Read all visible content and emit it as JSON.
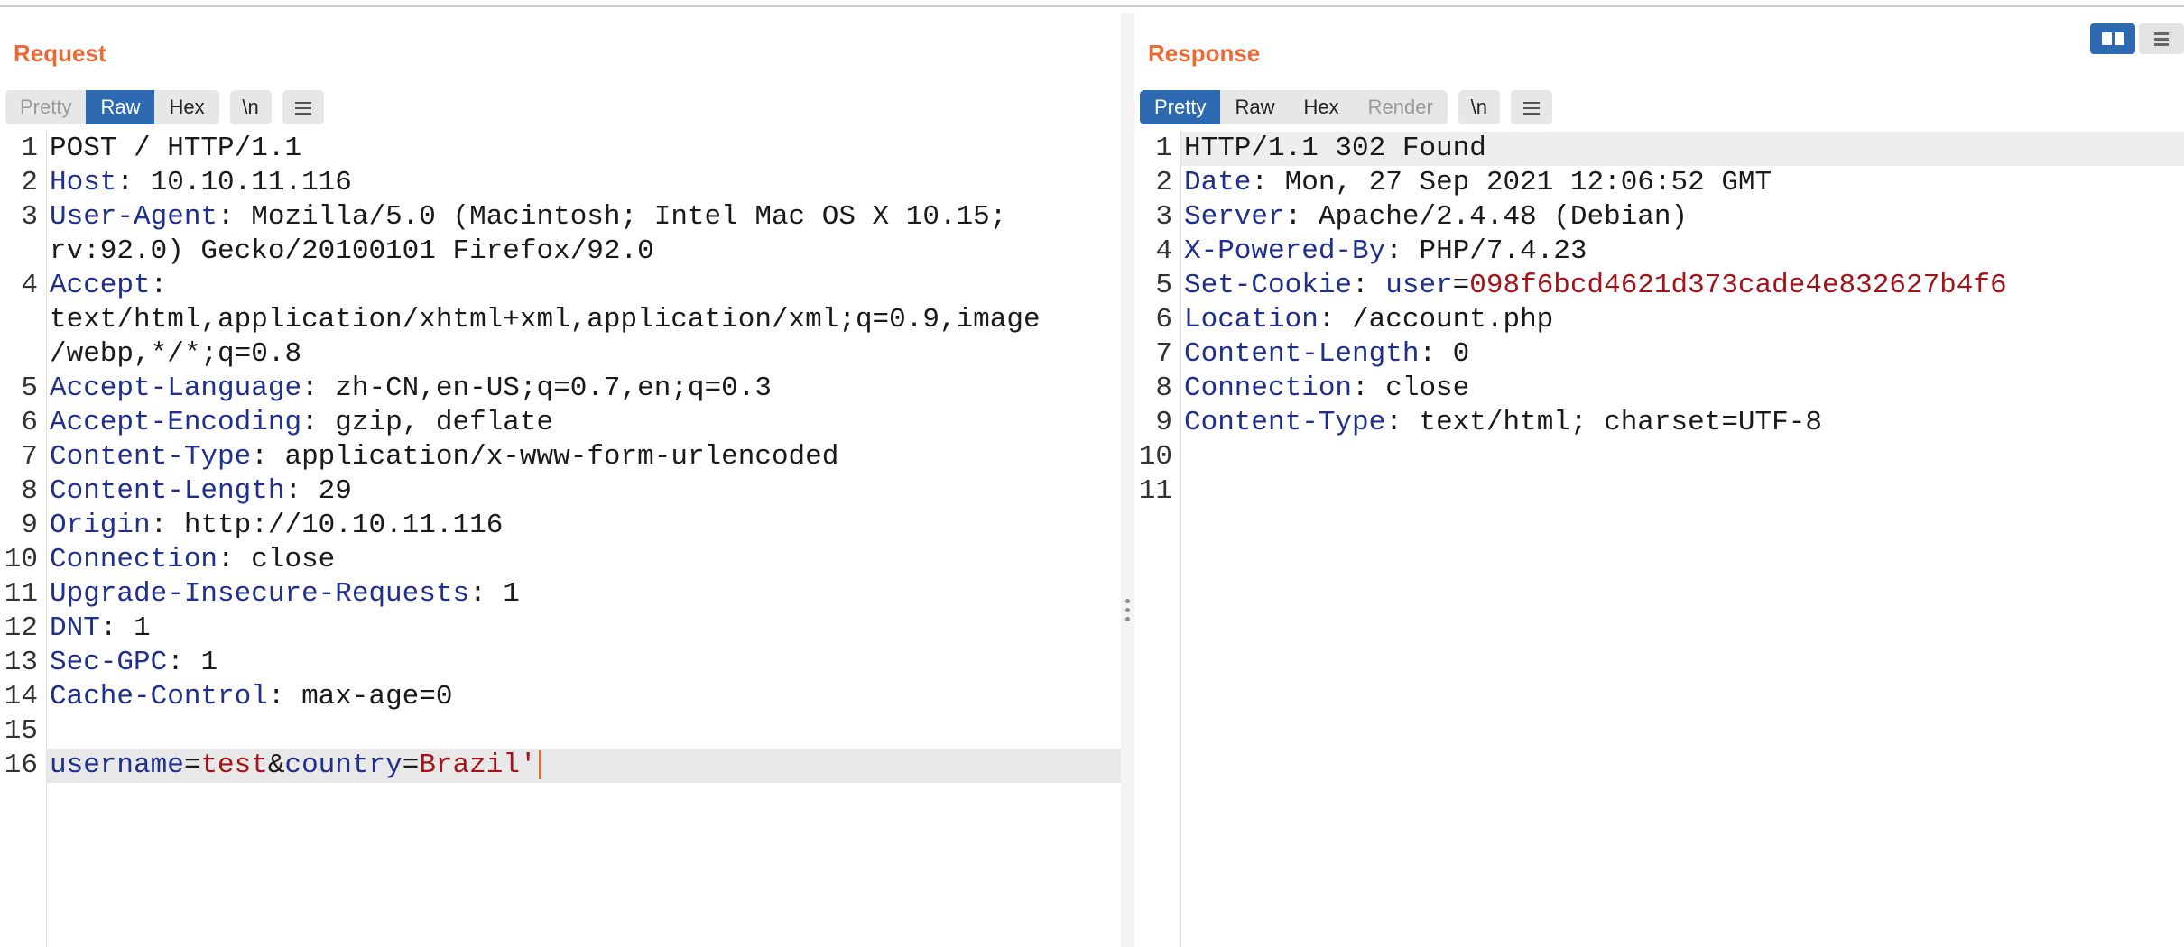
{
  "request": {
    "title": "Request",
    "tabs": [
      "Pretty",
      "Raw",
      "Hex"
    ],
    "newline_btn": "\\n",
    "menu_icon": "hamburger-icon",
    "lines": [
      {
        "n": "1",
        "k": "",
        "sep": "",
        "v": "POST / HTTP/1.1"
      },
      {
        "n": "2",
        "k": "Host",
        "sep": ": ",
        "v": "10.10.11.116"
      },
      {
        "n": "3",
        "k": "User-Agent",
        "sep": ": ",
        "v": "Mozilla/5.0 (Macintosh; Intel Mac OS X 10.15;"
      },
      {
        "n": "",
        "k": "",
        "sep": "",
        "v": "rv:92.0) Gecko/20100101 Firefox/92.0"
      },
      {
        "n": "4",
        "k": "Accept",
        "sep": ":",
        "v": ""
      },
      {
        "n": "",
        "k": "",
        "sep": "",
        "v": "text/html,application/xhtml+xml,application/xml;q=0.9,image"
      },
      {
        "n": "",
        "k": "",
        "sep": "",
        "v": "/webp,*/*;q=0.8"
      },
      {
        "n": "5",
        "k": "Accept-Language",
        "sep": ": ",
        "v": "zh-CN,en-US;q=0.7,en;q=0.3"
      },
      {
        "n": "6",
        "k": "Accept-Encoding",
        "sep": ": ",
        "v": "gzip, deflate"
      },
      {
        "n": "7",
        "k": "Content-Type",
        "sep": ": ",
        "v": "application/x-www-form-urlencoded"
      },
      {
        "n": "8",
        "k": "Content-Length",
        "sep": ": ",
        "v": "29"
      },
      {
        "n": "9",
        "k": "Origin",
        "sep": ": ",
        "v": "http://10.10.11.116"
      },
      {
        "n": "10",
        "k": "Connection",
        "sep": ": ",
        "v": "close"
      },
      {
        "n": "11",
        "k": "Upgrade-Insecure-Requests",
        "sep": ": ",
        "v": "1"
      },
      {
        "n": "12",
        "k": "DNT",
        "sep": ": ",
        "v": "1"
      },
      {
        "n": "13",
        "k": "Sec-GPC",
        "sep": ": ",
        "v": "1"
      },
      {
        "n": "14",
        "k": "Cache-Control",
        "sep": ": ",
        "v": "max-age=0"
      },
      {
        "n": "15",
        "k": "",
        "sep": "",
        "v": ""
      }
    ],
    "body_line": {
      "n": "16",
      "p1k": "username",
      "p1eq": "=",
      "p1v": "test",
      "amp": "&",
      "p2k": "country",
      "p2eq": "=",
      "p2v": "Brazil'"
    }
  },
  "response": {
    "title": "Response",
    "tabs": [
      "Pretty",
      "Raw",
      "Hex",
      "Render"
    ],
    "newline_btn": "\\n",
    "menu_icon": "hamburger-icon",
    "lines": [
      {
        "n": "1",
        "k": "",
        "sep": "",
        "v": "HTTP/1.1 302 Found"
      },
      {
        "n": "2",
        "k": "Date",
        "sep": ": ",
        "v": "Mon, 27 Sep 2021 12:06:52 GMT"
      },
      {
        "n": "3",
        "k": "Server",
        "sep": ": ",
        "v": "Apache/2.4.48 (Debian)"
      },
      {
        "n": "4",
        "k": "X-Powered-By",
        "sep": ": ",
        "v": "PHP/7.4.23"
      },
      {
        "n": "5",
        "k": "Set-Cookie",
        "sep": ": ",
        "v": "",
        "ck": "user",
        "ceq": "=",
        "cv": "098f6bcd4621d373cade4e832627b4f6"
      },
      {
        "n": "6",
        "k": "Location",
        "sep": ": ",
        "v": "/account.php"
      },
      {
        "n": "7",
        "k": "Content-Length",
        "sep": ": ",
        "v": "0"
      },
      {
        "n": "8",
        "k": "Connection",
        "sep": ": ",
        "v": "close"
      },
      {
        "n": "9",
        "k": "Content-Type",
        "sep": ": ",
        "v": "text/html; charset=UTF-8"
      },
      {
        "n": "10",
        "k": "",
        "sep": "",
        "v": ""
      },
      {
        "n": "11",
        "k": "",
        "sep": "",
        "v": ""
      }
    ]
  },
  "layout_toggle": {
    "side_by_side_icon": "columns-icon",
    "stacked_icon": "rows-icon"
  },
  "colors": {
    "accent": "#ea6a35",
    "tab_active": "#2d6ab2",
    "header_name": "#1f2f8c",
    "param_value": "#a3141a"
  }
}
